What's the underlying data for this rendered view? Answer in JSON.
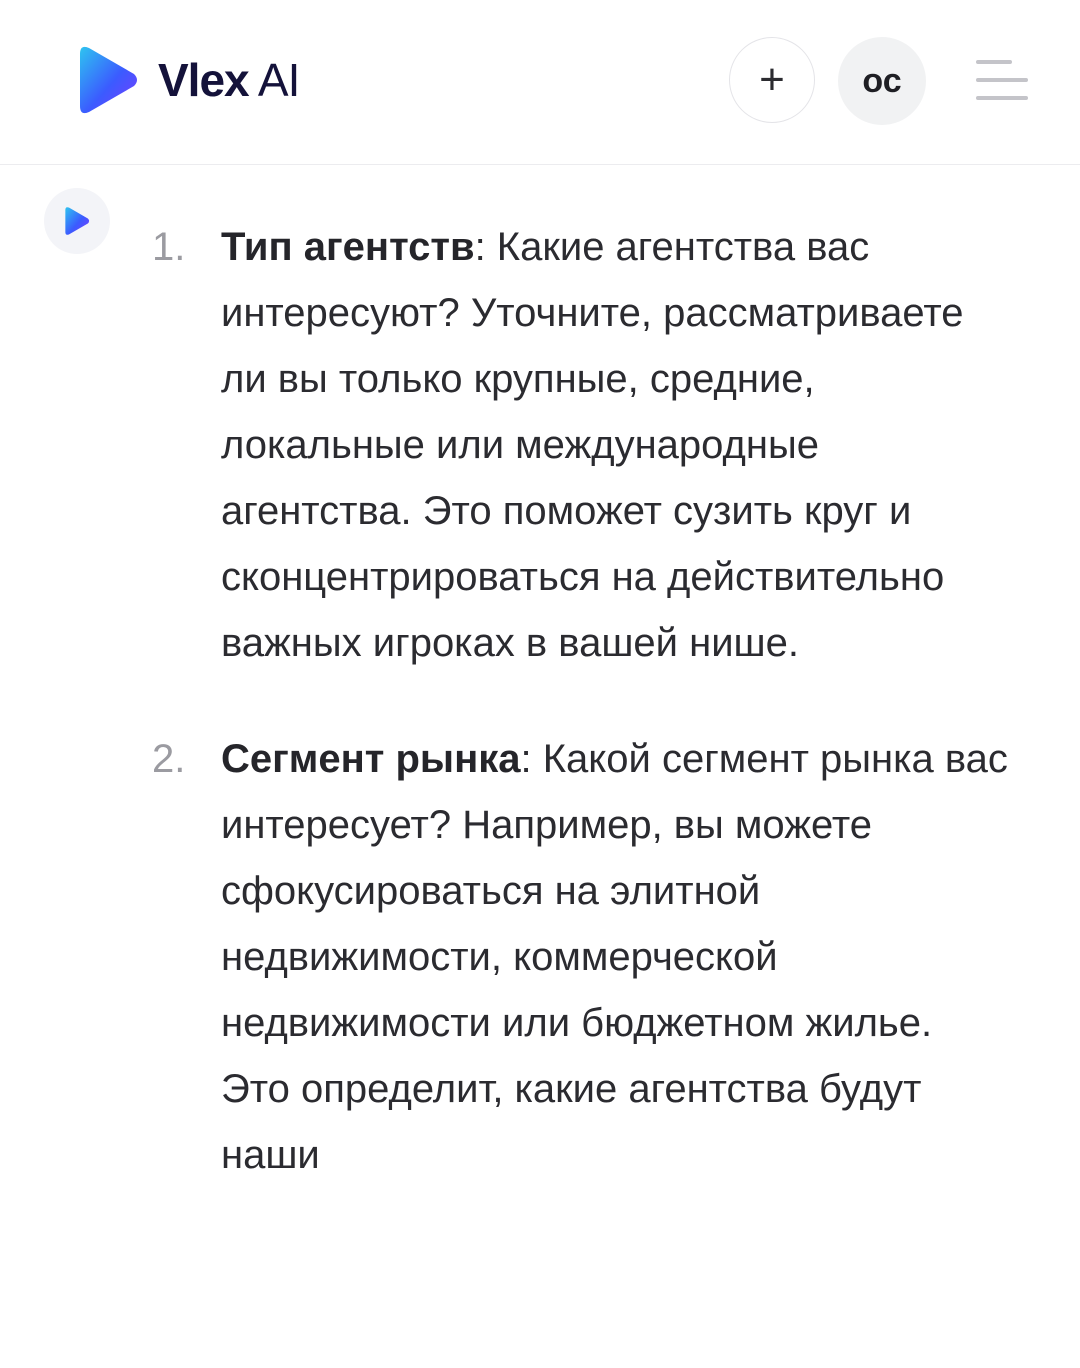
{
  "header": {
    "brand_bold": "Vlex",
    "brand_light": " AI",
    "new_chat_icon": "plus-icon",
    "new_chat_symbol": "+",
    "avatar_initials": "ос",
    "menu_icon": "hamburger-menu-icon"
  },
  "colors": {
    "logo_gradient_start": "#2ec4f0",
    "logo_gradient_mid": "#3b5bff",
    "logo_gradient_end": "#7a3cff",
    "text": "#2b2b30",
    "muted_number": "#9b9ba1"
  },
  "message": {
    "items": [
      {
        "number": "1.",
        "term": "Тип агентств",
        "text": ": Какие агентства вас интересуют? Уточните, рассматриваете ли вы только крупные, средние, локальные или международные агентства. Это поможет сузить круг и сконцентрироваться на действительно важных игроках в вашей нише."
      },
      {
        "number": "2.",
        "term": "Сегмент рынка",
        "text": ": Какой сегмент рынка вас интересует? Например, вы можете сфокусироваться на элитной недвижимости, коммерческой недвижимости или бюджетном жилье. Это определит, какие агентства будут наши"
      }
    ]
  }
}
